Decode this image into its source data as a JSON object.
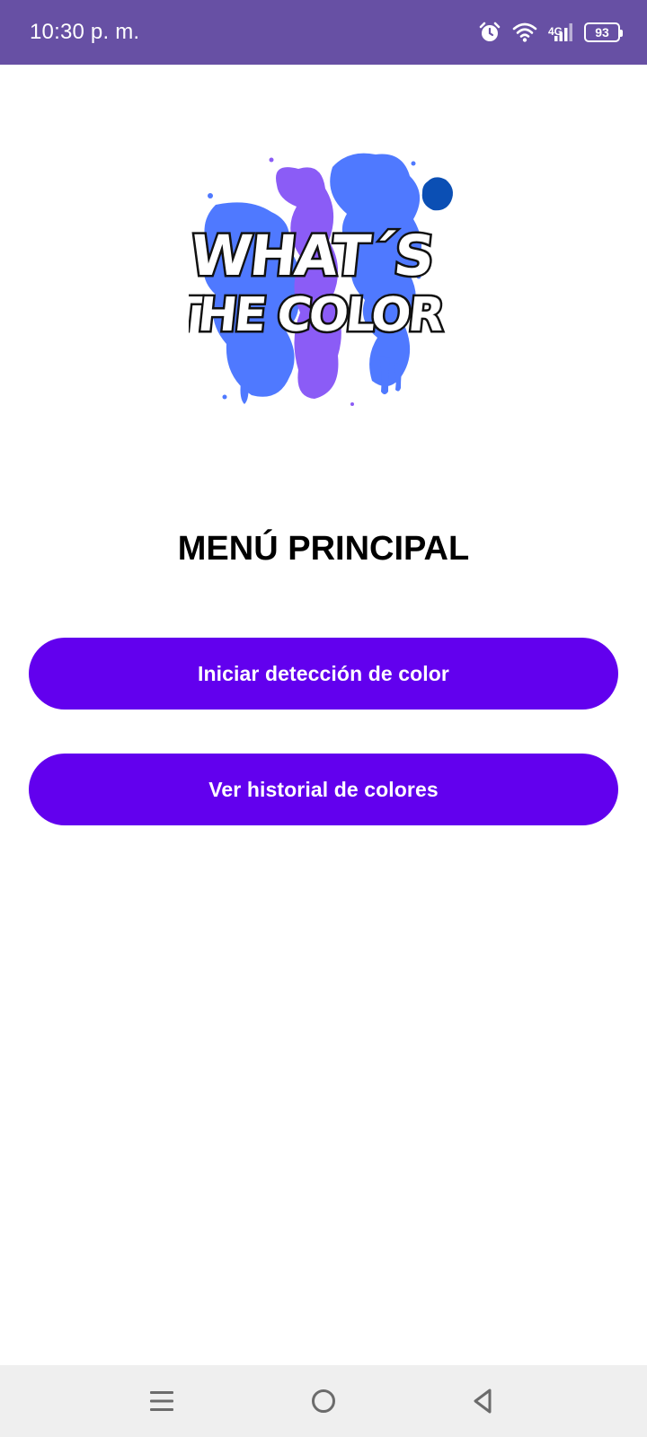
{
  "status_bar": {
    "time": "10:30 p. m.",
    "network": "4G",
    "battery": "93",
    "background_color": "#6750A4",
    "icons": [
      "alarm-icon",
      "wifi-icon",
      "signal-icon",
      "battery-icon"
    ]
  },
  "logo": {
    "line1": "WHAT´S",
    "line2": "THE COLOR",
    "splash_colors": [
      "#4F79FF",
      "#8B5CF6",
      "#0B4FB4"
    ]
  },
  "menu": {
    "title": "MENÚ PRINCIPAL",
    "buttons": [
      {
        "label": "Iniciar detección de color"
      },
      {
        "label": "Ver historial de colores"
      }
    ],
    "button_color": "#6200EE"
  },
  "nav_bar": {
    "icons": [
      "recent-apps-icon",
      "home-icon",
      "back-icon"
    ]
  }
}
